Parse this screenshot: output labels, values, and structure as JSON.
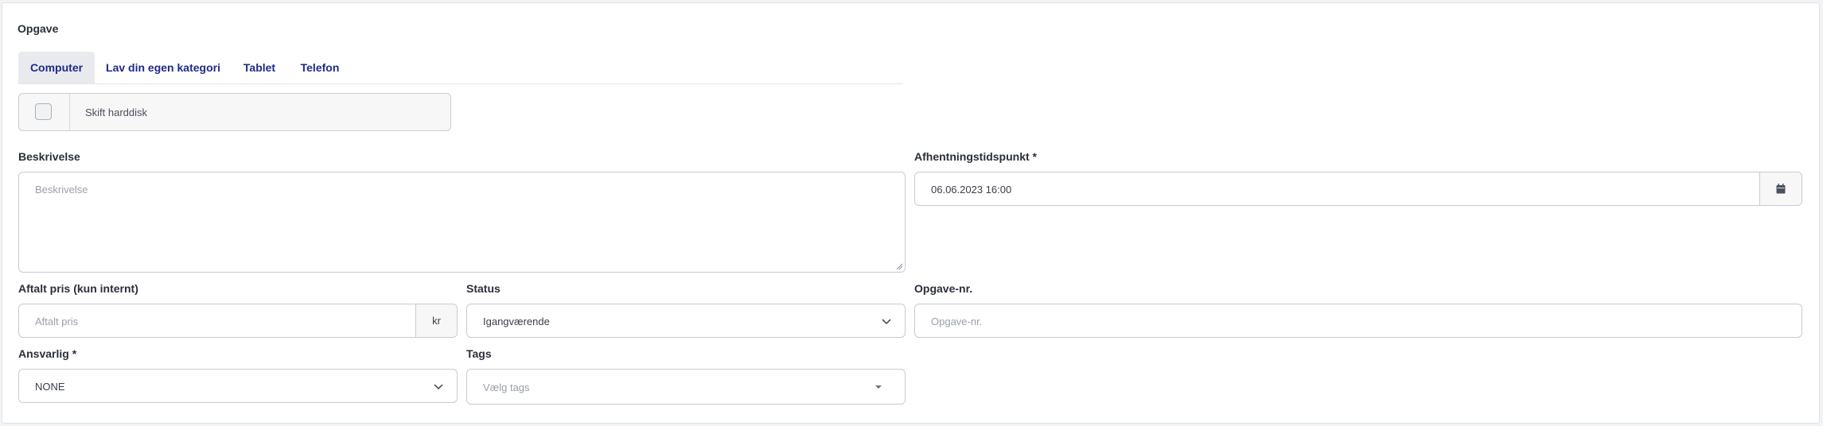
{
  "section": {
    "title": "Opgave"
  },
  "tabs": [
    {
      "label": "Computer",
      "active": true
    },
    {
      "label": "Lav din egen kategori",
      "active": false
    },
    {
      "label": "Tablet",
      "active": false
    },
    {
      "label": "Telefon",
      "active": false
    }
  ],
  "service": {
    "label": "Skift harddisk",
    "checked": false
  },
  "fields": {
    "description": {
      "label": "Beskrivelse",
      "placeholder": "Beskrivelse"
    },
    "pickup": {
      "label": "Afhentningstidspunkt",
      "required_mark": "*",
      "value": "06.06.2023 16:00",
      "icon": "calendar-icon"
    },
    "price": {
      "label": "Aftalt pris (kun internt)",
      "placeholder": "Aftalt pris",
      "addon": "kr"
    },
    "status": {
      "label": "Status",
      "value": "Igangværende"
    },
    "task_no": {
      "label": "Opgave-nr.",
      "placeholder": "Opgave-nr."
    },
    "responsible": {
      "label": "Ansvarlig",
      "required_mark": "*",
      "value": "NONE"
    },
    "tags": {
      "label": "Tags",
      "placeholder": "Vælg tags"
    }
  },
  "colors": {
    "tab_text": "#1f2a8a",
    "border": "#c7cbd3",
    "active_tab_bg": "#e9eaee"
  }
}
